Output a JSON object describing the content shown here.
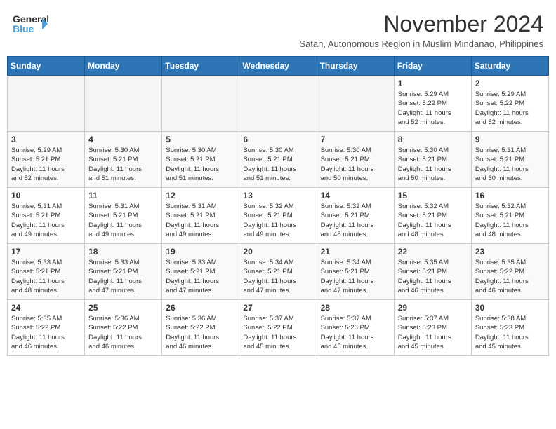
{
  "header": {
    "logo_general": "General",
    "logo_blue": "Blue",
    "month": "November 2024",
    "location": "Satan, Autonomous Region in Muslim Mindanao, Philippines"
  },
  "weekdays": [
    "Sunday",
    "Monday",
    "Tuesday",
    "Wednesday",
    "Thursday",
    "Friday",
    "Saturday"
  ],
  "weeks": [
    [
      {
        "day": "",
        "info": ""
      },
      {
        "day": "",
        "info": ""
      },
      {
        "day": "",
        "info": ""
      },
      {
        "day": "",
        "info": ""
      },
      {
        "day": "",
        "info": ""
      },
      {
        "day": "1",
        "info": "Sunrise: 5:29 AM\nSunset: 5:22 PM\nDaylight: 11 hours\nand 52 minutes."
      },
      {
        "day": "2",
        "info": "Sunrise: 5:29 AM\nSunset: 5:22 PM\nDaylight: 11 hours\nand 52 minutes."
      }
    ],
    [
      {
        "day": "3",
        "info": "Sunrise: 5:29 AM\nSunset: 5:21 PM\nDaylight: 11 hours\nand 52 minutes."
      },
      {
        "day": "4",
        "info": "Sunrise: 5:30 AM\nSunset: 5:21 PM\nDaylight: 11 hours\nand 51 minutes."
      },
      {
        "day": "5",
        "info": "Sunrise: 5:30 AM\nSunset: 5:21 PM\nDaylight: 11 hours\nand 51 minutes."
      },
      {
        "day": "6",
        "info": "Sunrise: 5:30 AM\nSunset: 5:21 PM\nDaylight: 11 hours\nand 51 minutes."
      },
      {
        "day": "7",
        "info": "Sunrise: 5:30 AM\nSunset: 5:21 PM\nDaylight: 11 hours\nand 50 minutes."
      },
      {
        "day": "8",
        "info": "Sunrise: 5:30 AM\nSunset: 5:21 PM\nDaylight: 11 hours\nand 50 minutes."
      },
      {
        "day": "9",
        "info": "Sunrise: 5:31 AM\nSunset: 5:21 PM\nDaylight: 11 hours\nand 50 minutes."
      }
    ],
    [
      {
        "day": "10",
        "info": "Sunrise: 5:31 AM\nSunset: 5:21 PM\nDaylight: 11 hours\nand 49 minutes."
      },
      {
        "day": "11",
        "info": "Sunrise: 5:31 AM\nSunset: 5:21 PM\nDaylight: 11 hours\nand 49 minutes."
      },
      {
        "day": "12",
        "info": "Sunrise: 5:31 AM\nSunset: 5:21 PM\nDaylight: 11 hours\nand 49 minutes."
      },
      {
        "day": "13",
        "info": "Sunrise: 5:32 AM\nSunset: 5:21 PM\nDaylight: 11 hours\nand 49 minutes."
      },
      {
        "day": "14",
        "info": "Sunrise: 5:32 AM\nSunset: 5:21 PM\nDaylight: 11 hours\nand 48 minutes."
      },
      {
        "day": "15",
        "info": "Sunrise: 5:32 AM\nSunset: 5:21 PM\nDaylight: 11 hours\nand 48 minutes."
      },
      {
        "day": "16",
        "info": "Sunrise: 5:32 AM\nSunset: 5:21 PM\nDaylight: 11 hours\nand 48 minutes."
      }
    ],
    [
      {
        "day": "17",
        "info": "Sunrise: 5:33 AM\nSunset: 5:21 PM\nDaylight: 11 hours\nand 48 minutes."
      },
      {
        "day": "18",
        "info": "Sunrise: 5:33 AM\nSunset: 5:21 PM\nDaylight: 11 hours\nand 47 minutes."
      },
      {
        "day": "19",
        "info": "Sunrise: 5:33 AM\nSunset: 5:21 PM\nDaylight: 11 hours\nand 47 minutes."
      },
      {
        "day": "20",
        "info": "Sunrise: 5:34 AM\nSunset: 5:21 PM\nDaylight: 11 hours\nand 47 minutes."
      },
      {
        "day": "21",
        "info": "Sunrise: 5:34 AM\nSunset: 5:21 PM\nDaylight: 11 hours\nand 47 minutes."
      },
      {
        "day": "22",
        "info": "Sunrise: 5:35 AM\nSunset: 5:21 PM\nDaylight: 11 hours\nand 46 minutes."
      },
      {
        "day": "23",
        "info": "Sunrise: 5:35 AM\nSunset: 5:22 PM\nDaylight: 11 hours\nand 46 minutes."
      }
    ],
    [
      {
        "day": "24",
        "info": "Sunrise: 5:35 AM\nSunset: 5:22 PM\nDaylight: 11 hours\nand 46 minutes."
      },
      {
        "day": "25",
        "info": "Sunrise: 5:36 AM\nSunset: 5:22 PM\nDaylight: 11 hours\nand 46 minutes."
      },
      {
        "day": "26",
        "info": "Sunrise: 5:36 AM\nSunset: 5:22 PM\nDaylight: 11 hours\nand 46 minutes."
      },
      {
        "day": "27",
        "info": "Sunrise: 5:37 AM\nSunset: 5:22 PM\nDaylight: 11 hours\nand 45 minutes."
      },
      {
        "day": "28",
        "info": "Sunrise: 5:37 AM\nSunset: 5:23 PM\nDaylight: 11 hours\nand 45 minutes."
      },
      {
        "day": "29",
        "info": "Sunrise: 5:37 AM\nSunset: 5:23 PM\nDaylight: 11 hours\nand 45 minutes."
      },
      {
        "day": "30",
        "info": "Sunrise: 5:38 AM\nSunset: 5:23 PM\nDaylight: 11 hours\nand 45 minutes."
      }
    ]
  ]
}
